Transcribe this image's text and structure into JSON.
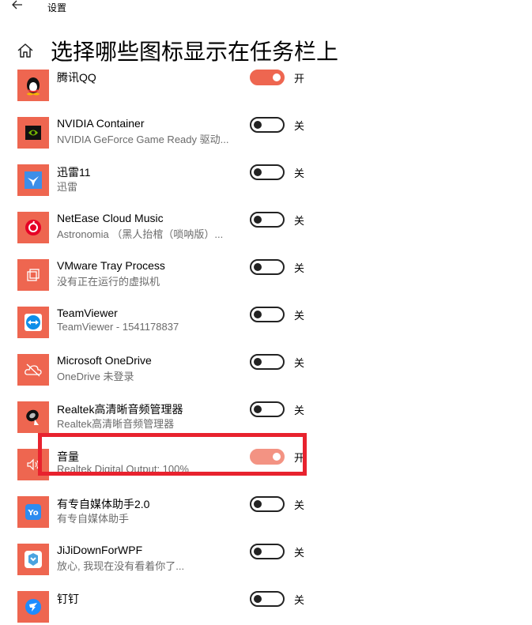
{
  "header": {
    "app_title": "设置",
    "page_title": "选择哪些图标显示在任务栏上"
  },
  "colors": {
    "accent": "#ee6650",
    "highlight": "#e8222e"
  },
  "apps": [
    {
      "name": "腾讯QQ",
      "desc": "",
      "state": "开",
      "on": true,
      "icon": "qq-penguin-icon"
    },
    {
      "name": "NVIDIA Container",
      "desc": "NVIDIA GeForce Game Ready 驱动...",
      "state": "关",
      "on": false,
      "icon": "nvidia-icon"
    },
    {
      "name": "迅雷11",
      "desc": "迅雷",
      "state": "关",
      "on": false,
      "icon": "thunder-bird-icon"
    },
    {
      "name": "NetEase Cloud Music",
      "desc": "Astronomia （黑人抬棺（唢呐版）...",
      "state": "关",
      "on": false,
      "icon": "netease-music-icon"
    },
    {
      "name": "VMware Tray Process",
      "desc": "没有正在运行的虚拟机",
      "state": "关",
      "on": false,
      "icon": "vmware-icon"
    },
    {
      "name": "TeamViewer",
      "desc": "TeamViewer - 1541178837",
      "state": "关",
      "on": false,
      "icon": "teamviewer-icon"
    },
    {
      "name": "Microsoft OneDrive",
      "desc": "OneDrive 未登录",
      "state": "关",
      "on": false,
      "icon": "onedrive-cloud-icon"
    },
    {
      "name": "Realtek高清晰音频管理器",
      "desc": "Realtek高清晰音频管理器",
      "state": "关",
      "on": false,
      "icon": "realtek-speaker-icon"
    },
    {
      "name": "音量",
      "desc": "Realtek Digital Output: 100%",
      "state": "开",
      "on": true,
      "icon": "volume-icon"
    },
    {
      "name": "有专自媒体助手2.0",
      "desc": "有专自媒体助手",
      "state": "关",
      "on": false,
      "icon": "youzhuan-icon"
    },
    {
      "name": "JiJiDownForWPF",
      "desc": "放心, 我现在没有看着你了...",
      "state": "关",
      "on": false,
      "icon": "jijidown-icon"
    },
    {
      "name": "钉钉",
      "desc": "",
      "state": "关",
      "on": false,
      "icon": "dingtalk-icon"
    }
  ]
}
